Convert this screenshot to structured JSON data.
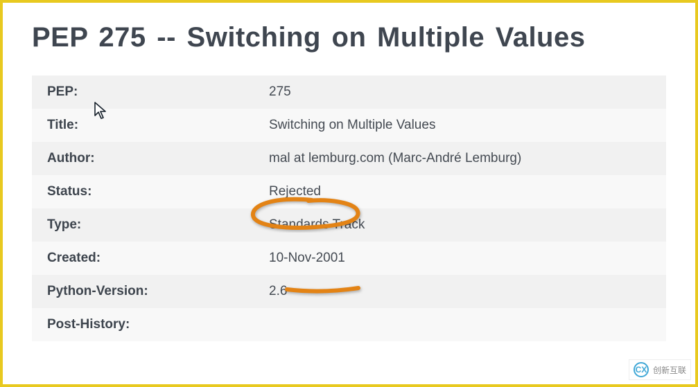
{
  "title": "PEP 275 -- Switching on Multiple Values",
  "rows": [
    {
      "label": "PEP:",
      "value": "275"
    },
    {
      "label": "Title:",
      "value": "Switching on Multiple Values"
    },
    {
      "label": "Author:",
      "value": "mal at lemburg.com (Marc-André Lemburg)"
    },
    {
      "label": "Status:",
      "value": "Rejected"
    },
    {
      "label": "Type:",
      "value": "Standards Track"
    },
    {
      "label": "Created:",
      "value": "10-Nov-2001"
    },
    {
      "label": "Python-Version:",
      "value": "2.6"
    },
    {
      "label": "Post-History:",
      "value": ""
    }
  ],
  "watermark": {
    "logo_text": "CX",
    "text": "创新互联"
  }
}
